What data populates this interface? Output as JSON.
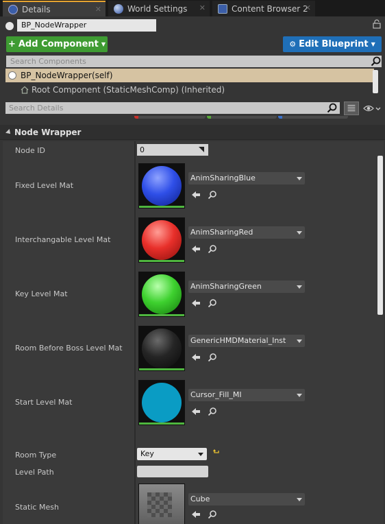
{
  "tabs": [
    {
      "label": "Details",
      "icon": "details-icon",
      "active": true
    },
    {
      "label": "World Settings",
      "icon": "globe-icon",
      "active": false
    },
    {
      "label": "Content Browser 2",
      "icon": "content-browser-icon",
      "active": false
    }
  ],
  "actor": {
    "name": "BP_NodeWrapper",
    "locked": false
  },
  "toolbar": {
    "add_component": "Add Component",
    "edit_blueprint": "Edit Blueprint"
  },
  "components": {
    "search_placeholder": "Search Components",
    "items": [
      {
        "label": "BP_NodeWrapper(self)",
        "selected": true
      },
      {
        "label": "Root Component (StaticMeshComp) (Inherited)",
        "selected": false
      }
    ]
  },
  "details": {
    "search_placeholder": "Search Details"
  },
  "category": {
    "label": "Node Wrapper",
    "expanded": true
  },
  "properties": {
    "node_id": {
      "label": "Node ID",
      "value": "0"
    },
    "fixed_level_mat": {
      "label": "Fixed Level Mat",
      "asset": "AnimSharingBlue"
    },
    "interchangable_level_mat": {
      "label": "Interchangable Level Mat",
      "asset": "AnimSharingRed"
    },
    "key_level_mat": {
      "label": "Key Level Mat",
      "asset": "AnimSharingGreen"
    },
    "room_before_boss_level_mat": {
      "label": "Room Before Boss Level Mat",
      "asset": "GenericHMDMaterial_Inst"
    },
    "start_level_mat": {
      "label": "Start Level Mat",
      "asset": "Cursor_Fill_MI"
    },
    "room_type": {
      "label": "Room Type",
      "value": "Key"
    },
    "level_path": {
      "label": "Level Path",
      "value": ""
    },
    "static_mesh": {
      "label": "Static Mesh",
      "asset": "Cube"
    }
  },
  "colors": {
    "accent_tab": "#e8a530",
    "add_component_bg": "#3e9b32",
    "edit_blueprint_bg": "#1f6fb8",
    "selected_row": "#d6c3a2",
    "material_underline": "#4fb63f",
    "mesh_underline": "#37c7d8",
    "sphere_blue": "#2f4fe8",
    "sphere_red": "#e82f2a",
    "sphere_green": "#3ed12f",
    "sphere_black": "#1b1b1b",
    "sphere_cyan": "#0a9cc4"
  }
}
